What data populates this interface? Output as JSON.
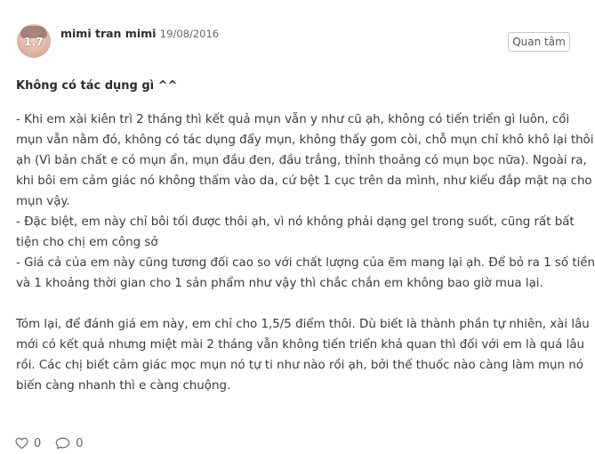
{
  "review": {
    "author": "mimi tran mimi",
    "date": "- 19/08/2016",
    "score": "1.7",
    "follow_label": "Quan tâm",
    "title": "Không có tác dụng gì ^^",
    "paragraph1": [
      "- Khi em xài kiên trì 2 tháng thì kết quả mụn vẫn y như cũ ạh, không có tiến triển gì luôn, cồi",
      "mụn vẫn nằm đó, không có tác dụng đẩy mụn, không thấy gom còi, chỗ mụn chỉ khô khô lại thôi",
      "ạh (Vì bản chất e có mụn ẩn, mụn đầu đen, đầu trắng, thỉnh thoảng có mụn bọc nữa). Ngoài ra,",
      "khi bôi em cảm giác nó không thấm vào da, cứ bệt 1 cục trên da mình, như kiểu đắp mặt nạ cho",
      "mụn vậy.",
      "- Đặc biệt, em này chỉ bôi tối được thôi ạh, vì nó không phải dạng gel trong suốt, cũng rất bất",
      "tiện cho chị em công sở",
      "- Giá cả của em này cũng tương đối cao so với chất lượng của ẽm mang lại ạh. Để bỏ ra 1 số tiền",
      "và 1 khoảng thời gian cho 1 sản phẩm như vậy thì chắc chắn em không bao giờ mua lại."
    ],
    "paragraph2": [
      "Tóm lại, để đánh giá em này, em chỉ cho 1,5/5 điểm thôi. Dù biết là thành phần tự nhiên, xài lâu",
      "mới có kết quả nhưng miệt mài 2 tháng vẫn không tiến triển khả quan thì đối với em là quá lâu",
      "rồi. Các chị biết cảm giác mọc mụn nó tự ti như nào rồi ạh, bởi thế thuốc nào càng làm mụn nó",
      "biến càng nhanh thì e càng chuộng."
    ],
    "likes": "0",
    "comments": "0",
    "icons": {
      "like": "heart-icon",
      "comment": "comment-icon"
    }
  }
}
